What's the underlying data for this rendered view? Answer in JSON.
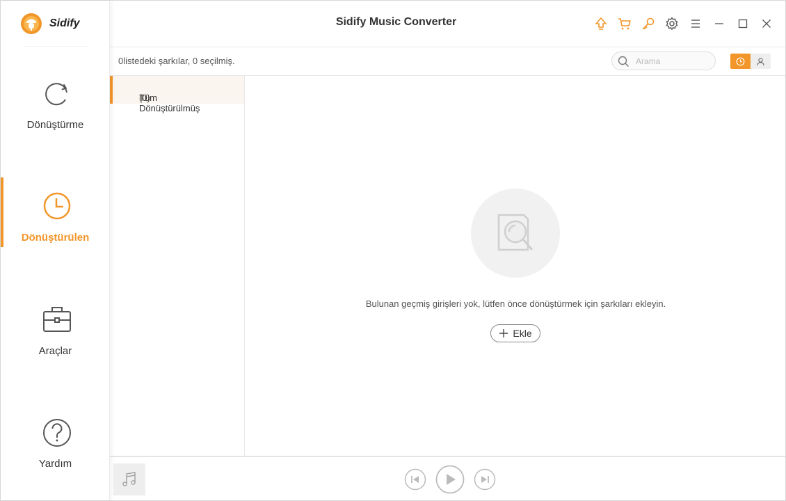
{
  "app": {
    "name": "Sidify",
    "window_title": "Sidify Music Converter"
  },
  "colors": {
    "accent": "#f2962a",
    "text": "#333333",
    "muted": "#999999",
    "panel_active_bg": "#faf5ee"
  },
  "sidebar": {
    "items": [
      {
        "label": "Dönüştürme",
        "icon": "refresh-icon",
        "active": false
      },
      {
        "label": "Dönüştürülen",
        "icon": "clock-icon",
        "active": true
      },
      {
        "label": "Araçlar",
        "icon": "toolbox-icon",
        "active": false
      },
      {
        "label": "Yardım",
        "icon": "help-icon",
        "active": false
      }
    ]
  },
  "header": {
    "buttons": [
      "upgrade-icon",
      "cart-icon",
      "key-icon",
      "gear-icon",
      "menu-icon",
      "minimize-icon",
      "maximize-icon",
      "close-icon"
    ]
  },
  "toolbar": {
    "count_text": "0listedeki şarkılar, 0 seçilmiş.",
    "search_placeholder": "Arama",
    "view_toggle": [
      "clock-icon",
      "user-icon"
    ]
  },
  "categories": [
    {
      "label": "Tüm Dönüştürülmüş",
      "count": "(0)"
    }
  ],
  "empty_state": {
    "message": "Bulunan geçmiş girişleri yok, lütfen önce dönüştürmek için şarkıları ekleyin.",
    "add_label": "Ekle"
  },
  "player": {
    "buttons": [
      "previous-icon",
      "play-icon",
      "next-icon"
    ]
  }
}
